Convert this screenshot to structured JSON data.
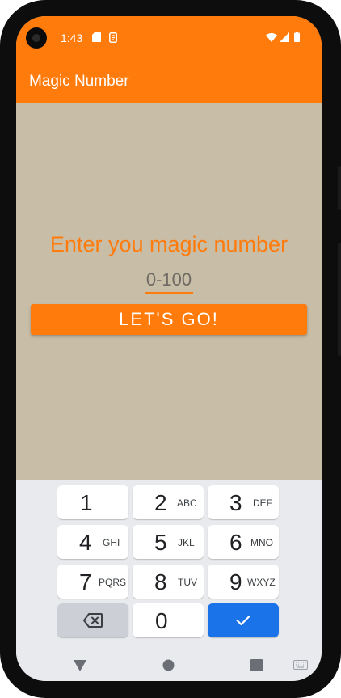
{
  "status_bar": {
    "time": "1:43",
    "icons": [
      "sd-card-icon",
      "sim-icon",
      "wifi-icon",
      "signal-icon",
      "battery-icon"
    ]
  },
  "app_bar": {
    "title": "Magic Number"
  },
  "main": {
    "prompt": "Enter you magic number",
    "input_value": "",
    "input_placeholder": "0-100",
    "go_button_label": "LET'S GO!"
  },
  "keyboard": {
    "keys": [
      {
        "digit": "1",
        "letters": ""
      },
      {
        "digit": "2",
        "letters": "ABC"
      },
      {
        "digit": "3",
        "letters": "DEF"
      },
      {
        "digit": "4",
        "letters": "GHI"
      },
      {
        "digit": "5",
        "letters": "JKL"
      },
      {
        "digit": "6",
        "letters": "MNO"
      },
      {
        "digit": "7",
        "letters": "PQRS"
      },
      {
        "digit": "8",
        "letters": "TUV"
      },
      {
        "digit": "9",
        "letters": "WXYZ"
      },
      {
        "digit": "0",
        "letters": ""
      }
    ],
    "special_keys": [
      "backspace-icon",
      "check-icon"
    ]
  },
  "nav_bar": {
    "icons": [
      "back-triangle-icon",
      "home-circle-icon",
      "recents-square-icon",
      "keyboard-switch-icon"
    ]
  },
  "colors": {
    "accent": "#ff7b0c",
    "background": "#c8bda6",
    "keyboard_bg": "#e8eaed",
    "action_blue": "#1a73e8"
  }
}
